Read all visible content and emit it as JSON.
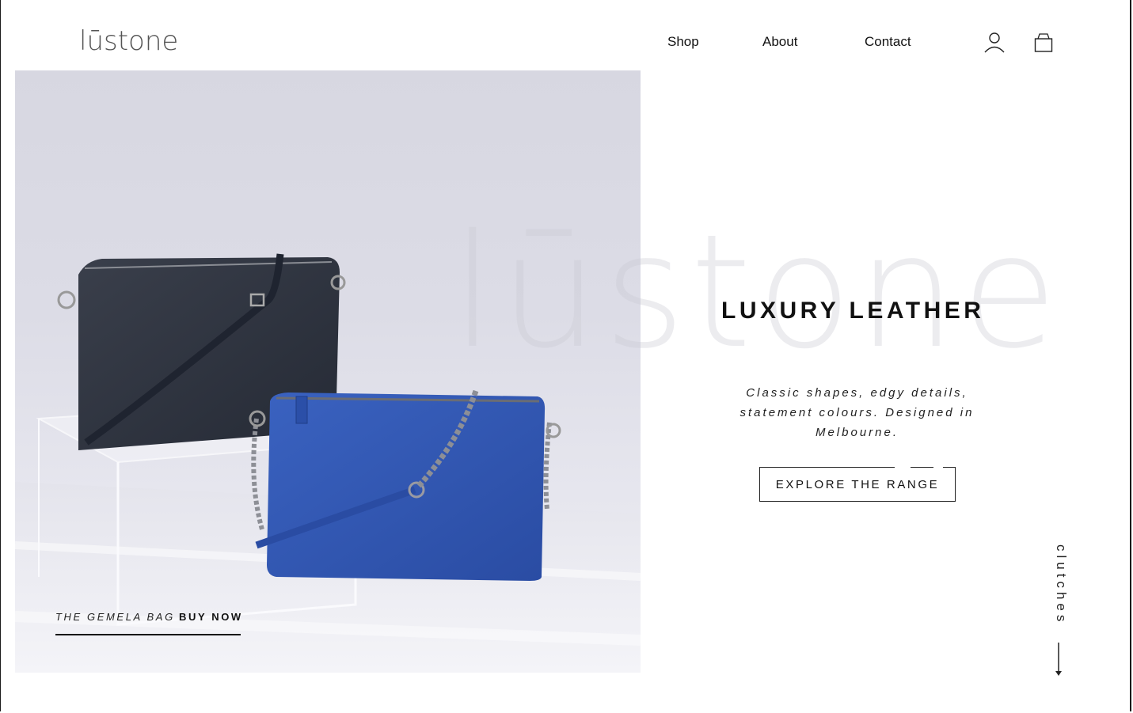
{
  "brand": {
    "logo_text": "lūstone",
    "watermark_text": "lūstone"
  },
  "nav": {
    "items": [
      {
        "label": "Shop"
      },
      {
        "label": "About"
      },
      {
        "label": "Contact"
      }
    ]
  },
  "header_icons": {
    "account": "user-icon",
    "cart": "shopping-bag-icon"
  },
  "hero": {
    "caption_name": "THE GEMELA BAG",
    "caption_cta": "BUY NOW",
    "headline": "LUXURY LEATHER",
    "tagline": "Classic shapes, edgy details, statement colours. Designed in Melbourne.",
    "cta_label": "EXPLORE THE RANGE",
    "side_label": "clutches"
  },
  "colors": {
    "navy_bag": "#2e323c",
    "blue_bag": "#2f55b1",
    "text": "#111111",
    "background": "#ffffff"
  }
}
